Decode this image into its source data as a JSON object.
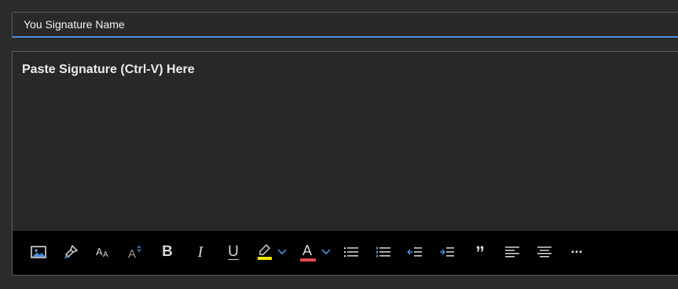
{
  "signature_name": {
    "value": "You Signature Name"
  },
  "editor": {
    "placeholder": "Paste Signature (Ctrl-V) Here"
  },
  "toolbar": {
    "items": [
      {
        "name": "insert-picture",
        "icon": "image-icon"
      },
      {
        "name": "format-painter",
        "icon": "paintbrush-icon"
      },
      {
        "name": "font-size",
        "icon": "font-size-icon"
      },
      {
        "name": "change-case",
        "icon": "change-case-icon"
      },
      {
        "name": "bold",
        "icon": "bold-icon",
        "glyph": "B"
      },
      {
        "name": "italic",
        "icon": "italic-icon",
        "glyph": "I"
      },
      {
        "name": "underline",
        "icon": "underline-icon",
        "glyph": "U"
      },
      {
        "name": "highlight",
        "icon": "highlighter-icon"
      },
      {
        "name": "font-color",
        "icon": "font-color-icon",
        "glyph": "A"
      },
      {
        "name": "bullets",
        "icon": "bulleted-list-icon"
      },
      {
        "name": "numbering",
        "icon": "numbered-list-icon"
      },
      {
        "name": "decrease-indent",
        "icon": "decrease-indent-icon"
      },
      {
        "name": "increase-indent",
        "icon": "increase-indent-icon"
      },
      {
        "name": "quote",
        "icon": "quote-icon",
        "glyph": "”"
      },
      {
        "name": "align-left",
        "icon": "align-left-icon"
      },
      {
        "name": "align-center",
        "icon": "align-center-icon"
      },
      {
        "name": "more",
        "icon": "more-icon",
        "glyph": "···"
      }
    ]
  },
  "colors": {
    "background": "#2b2b2b",
    "toolbar": "#000000",
    "focus_underline": "#4a90d9",
    "highlight_yellow": "#f2e600",
    "font_color_red": "#e34b4b",
    "caret_blue": "#4a90d9"
  }
}
